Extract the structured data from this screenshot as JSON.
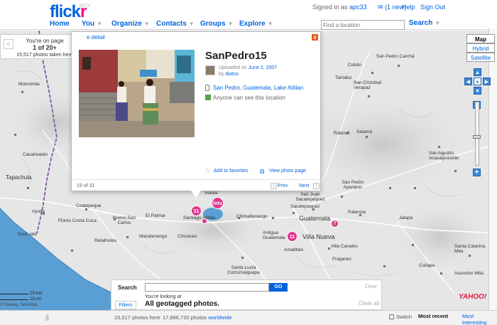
{
  "header": {
    "logo_a": "flick",
    "logo_b": "r",
    "logo_badge": "BETA",
    "nav": [
      {
        "label": "Home",
        "has_menu": false
      },
      {
        "label": "You",
        "has_menu": true
      },
      {
        "label": "Organize",
        "has_menu": true
      },
      {
        "label": "Contacts",
        "has_menu": true
      },
      {
        "label": "Groups",
        "has_menu": true
      },
      {
        "label": "Explore",
        "has_menu": true
      }
    ],
    "signed_in_prefix": "Signed in as",
    "username": "apc33",
    "new_count": "(1 new)",
    "help": "Help",
    "sign_out": "Sign Out",
    "location_placeholder": "Find a location",
    "search": "Search"
  },
  "counter": {
    "prev": "<",
    "next": ">",
    "line1": "You're on page",
    "line2": "1 of 20+",
    "taken": "15,517 photos taken here"
  },
  "popup": {
    "detail_link": "e detail",
    "close": "x",
    "title": "SanPedro15",
    "uploaded_prefix": "Uploaded on",
    "uploaded_date": "June 2, 2007",
    "by_prefix": "by",
    "author": "dwtno",
    "location": "San Pedro, Guatemala, Lake Atitlan",
    "permission": "Anyone can see this location",
    "add_fav": "Add to favorites",
    "view_page": "View photo page",
    "index": "19 of 31",
    "prev": "Prev",
    "next": "Next"
  },
  "map_types": [
    "Map",
    "Hybrid",
    "Satellite"
  ],
  "map_places": [
    {
      "label": "Cubán",
      "big": false
    },
    {
      "label": "San Pedro Carchá",
      "big": false
    },
    {
      "label": "Tamahú",
      "big": false
    },
    {
      "label": "San Cristóbal Verapaz",
      "big": false
    },
    {
      "label": "Motocintla",
      "big": false
    },
    {
      "label": "Cacahoatán",
      "big": false
    },
    {
      "label": "Tapachula",
      "big": false
    },
    {
      "label": "Rabinal",
      "big": false
    },
    {
      "label": "Salamá",
      "big": false
    },
    {
      "label": "San Agustín Acasaguastlán",
      "big": false
    },
    {
      "label": "Sololá",
      "big": false
    },
    {
      "label": "San Juan Sacatepéquez",
      "big": false
    },
    {
      "label": "San Pedro Ayampuc",
      "big": false
    },
    {
      "label": "Guatemala",
      "big": true
    },
    {
      "label": "Villa Nueva",
      "big": true
    },
    {
      "label": "Villa Canales",
      "big": false
    },
    {
      "label": "Fraijanes",
      "big": false
    },
    {
      "label": "Amatitlán",
      "big": false
    },
    {
      "label": "Antigua Guatemala",
      "big": false
    },
    {
      "label": "Chimaltenango",
      "big": false
    },
    {
      "label": "Coatepeque",
      "big": false
    },
    {
      "label": "Flores Costa Cuca",
      "big": false
    },
    {
      "label": "El Palmar",
      "big": false
    },
    {
      "label": "Nuevo San Carlos",
      "big": false
    },
    {
      "label": "Mazatenango",
      "big": false
    },
    {
      "label": "Chicacao",
      "big": false
    },
    {
      "label": "Retalhuleu",
      "big": false
    },
    {
      "label": "Santa Lucía Cotzumalguapa",
      "big": false
    },
    {
      "label": "Palencia",
      "big": false
    },
    {
      "label": "Jalapa",
      "big": false
    },
    {
      "label": "Cuilapa",
      "big": false
    },
    {
      "label": "Ayutla",
      "big": false
    },
    {
      "label": "Such iate",
      "big": false
    },
    {
      "label": "Santiago Atitlán",
      "big": false
    },
    {
      "label": "Santa Catarina Mita",
      "big": false
    },
    {
      "label": "Asunción Mita",
      "big": false
    },
    {
      "label": "Sacatepéquez",
      "big": false
    }
  ],
  "clusters": [
    "31",
    "lots",
    "11",
    "7"
  ],
  "search_panel": {
    "label": "Search",
    "go": "GO",
    "clear": "Clear",
    "looking": "You're looking at",
    "all": "All geotagged photos.",
    "clear_all": "Clear all",
    "filters": "Filters"
  },
  "scale": {
    "top": "20 km",
    "bottom": "10 mi"
  },
  "copyright": "© Navteq, TeleAtlas",
  "yahoo": "YAHOO!",
  "footer": {
    "pause": "||",
    "count": "15,517 photos here",
    "total_prefix": "17,886,720 photos",
    "total_link": "worldwide",
    "switch": "Switch",
    "most_recent": "Most recent",
    "interesting": "Most interesting"
  },
  "colors": {
    "brand_blue": "#0063dc",
    "brand_pink": "#ff0084",
    "cluster_pink": "#e0378e",
    "water": "#5a9fd4"
  },
  "icons": {
    "close": "close-icon",
    "favorite": "star-icon",
    "view": "photo-icon",
    "permission": "eye-icon",
    "location": "pin-icon"
  }
}
